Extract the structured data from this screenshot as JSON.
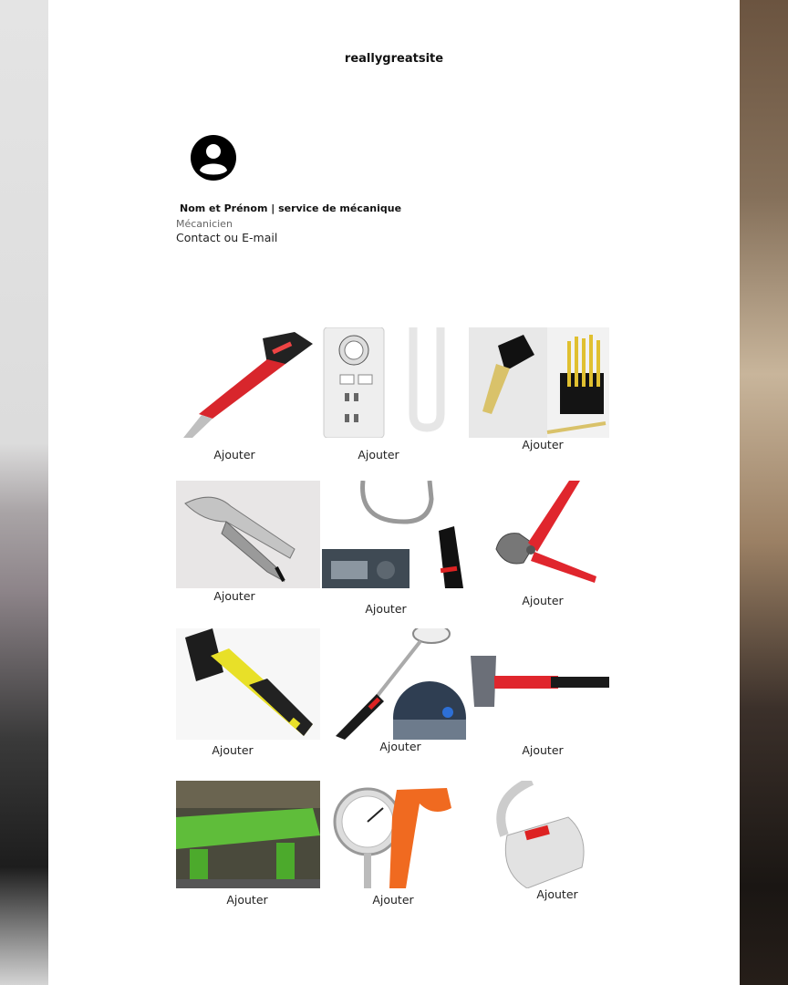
{
  "header": {
    "site_name": "reallygreatsite"
  },
  "profile": {
    "avatar_icon": "user-circle-icon",
    "name_line": "Nom et Prénom | service de mécanique",
    "role": "Mécanicien",
    "contact": "Contact ou E-mail"
  },
  "products": [
    {
      "image": "scraper-tool-image",
      "add_label": "Ajouter"
    },
    {
      "image": "timer-power-strip-image",
      "add_label": "Ajouter"
    },
    {
      "image": "chisel-set-image",
      "add_label": "Ajouter"
    },
    {
      "image": "locking-pliers-image",
      "add_label": "Ajouter"
    },
    {
      "image": "flexible-inspection-tool-image",
      "add_label": "Ajouter"
    },
    {
      "image": "cable-cutter-image",
      "add_label": "Ajouter"
    },
    {
      "image": "rubber-mallet-image",
      "add_label": "Ajouter"
    },
    {
      "image": "inspection-mirror-image",
      "add_label": "Ajouter"
    },
    {
      "image": "machinist-hammer-image",
      "add_label": "Ajouter"
    },
    {
      "image": "metal-shear-machine-image",
      "add_label": "Ajouter"
    },
    {
      "image": "dial-thickness-gauge-image",
      "add_label": "Ajouter"
    },
    {
      "image": "tape-measure-image",
      "add_label": "Ajouter"
    }
  ],
  "colors": {
    "page": "#ffffff",
    "text": "#222222",
    "accent_red": "#e0262d"
  }
}
